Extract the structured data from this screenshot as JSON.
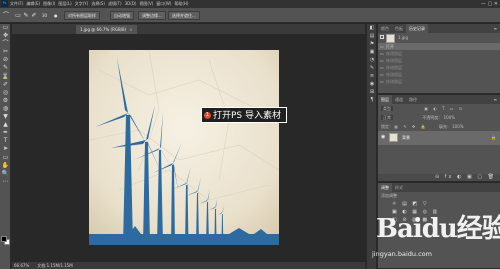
{
  "menubar": {
    "logo": "Ps",
    "items": [
      "文件(F)",
      "编辑(E)",
      "图像(I)",
      "图层(L)",
      "文字(Y)",
      "选择(S)",
      "滤镜(T)",
      "3D(D)",
      "视图(V)",
      "窗口(W)",
      "帮助(H)"
    ],
    "window_controls": "— ▢ ✕"
  },
  "options": {
    "size_value": "30",
    "mode_label": "模式：",
    "mode_value": "正常",
    "opacity_label": "不透明度：",
    "opacity_value": "100%",
    "flow_label": "流量：",
    "flow_value": "100%",
    "btn_sample": "对所有图层取样",
    "btn_auto": "自动增强",
    "btn_refine": "调整边缘...",
    "btn_select_subject": "选择并遮住..."
  },
  "tools": [
    "▭",
    "✥",
    "⌒",
    "✂",
    "⊘",
    "✎",
    "⌛",
    "✐",
    "◎",
    "⚙",
    "◍",
    "▼",
    "▲",
    "✒",
    "T",
    "➤",
    "▭",
    "✋",
    "🔍",
    "⋯"
  ],
  "document": {
    "tab_label": "1.jpg @ 66.7% (RGB/8)",
    "close": "×"
  },
  "callout": {
    "number": "1",
    "text": "打开PS 导入素材"
  },
  "status": {
    "zoom": "66.67%",
    "doc_size": "文档:1.15M/1.15M"
  },
  "dock": [
    "◧",
    "▤",
    "⚑",
    "▣",
    "◔",
    "✎",
    "≡",
    "◉",
    "⊞",
    "¶"
  ],
  "history_panel": {
    "tabs": [
      "颜色",
      "色板",
      "历史记录"
    ],
    "menu": "≡",
    "snapshot": "1.jpg",
    "rows": [
      {
        "label": "打开",
        "state": "normal"
      },
      {
        "label": "修改图层",
        "state": "dim"
      },
      {
        "label": "修改图层",
        "state": "dim"
      },
      {
        "label": "修改图层",
        "state": "dim"
      },
      {
        "label": "修改图层",
        "state": "dim"
      },
      {
        "label": "修改图层",
        "state": "dim"
      }
    ]
  },
  "layers_panel": {
    "tabs": [
      "图层",
      "通道",
      "路径"
    ],
    "menu": "≡",
    "filter": "类型",
    "blend_mode": "正常",
    "opacity_label": "不透明度：",
    "opacity_value": "100%",
    "lock_label": "锁定：",
    "fill_label": "填充：",
    "fill_value": "100%",
    "layer_name": "背景",
    "bottom_icons": "⊝ fx ◐ ▣ ▢ 🗑"
  },
  "adjust_panel": {
    "tabs": [
      "调整",
      "样式"
    ],
    "title": "添加调整"
  },
  "watermark": {
    "logo": "Baidu经验",
    "url": "jingyan.baidu.com"
  }
}
